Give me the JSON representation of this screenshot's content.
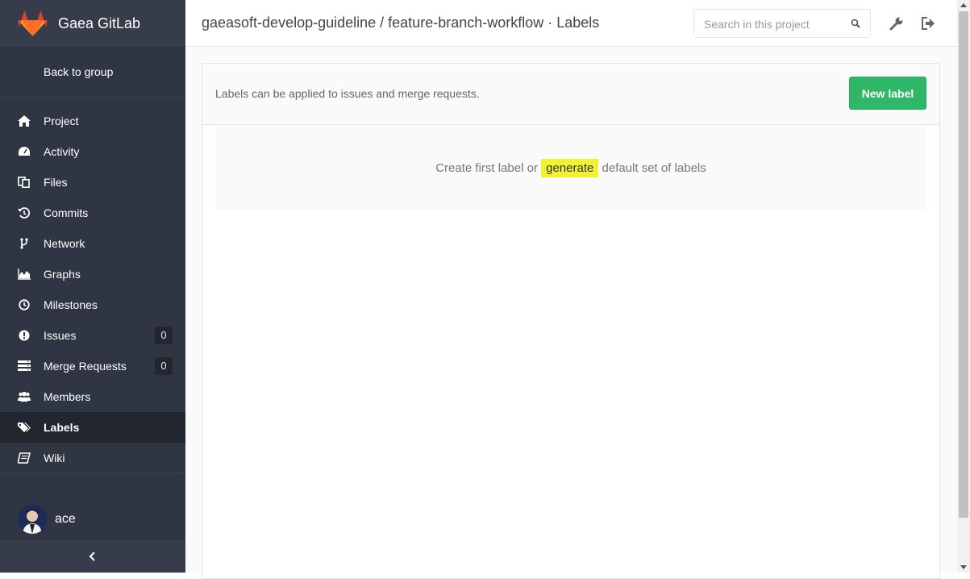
{
  "app": {
    "name": "Gaea GitLab"
  },
  "sidebar": {
    "back_label": "Back to group",
    "items": [
      {
        "label": "Project",
        "icon": "home-icon"
      },
      {
        "label": "Activity",
        "icon": "dashboard-icon"
      },
      {
        "label": "Files",
        "icon": "files-icon"
      },
      {
        "label": "Commits",
        "icon": "history-icon"
      },
      {
        "label": "Network",
        "icon": "code-fork-icon"
      },
      {
        "label": "Graphs",
        "icon": "area-chart-icon"
      },
      {
        "label": "Milestones",
        "icon": "clock-icon"
      },
      {
        "label": "Issues",
        "icon": "exclamation-circle-icon",
        "count": "0"
      },
      {
        "label": "Merge Requests",
        "icon": "merge-request-icon",
        "count": "0"
      },
      {
        "label": "Members",
        "icon": "users-icon"
      },
      {
        "label": "Labels",
        "icon": "tags-icon",
        "active": true
      },
      {
        "label": "Wiki",
        "icon": "book-icon"
      }
    ],
    "user": {
      "name": "ace"
    }
  },
  "header": {
    "title": "gaeasoft-develop-guideline / feature-branch-workflow · Labels",
    "search_placeholder": "Search in this project"
  },
  "main": {
    "description": "Labels can be applied to issues and merge requests.",
    "new_label_button": "New label",
    "empty": {
      "prefix": "Create first label or ",
      "link": "generate",
      "suffix": " default set of labels"
    }
  },
  "colors": {
    "sidebar_bg": "#2f3542",
    "sidebar_active": "#22262f",
    "button_green": "#2fb768",
    "highlight": "#f2f230"
  }
}
